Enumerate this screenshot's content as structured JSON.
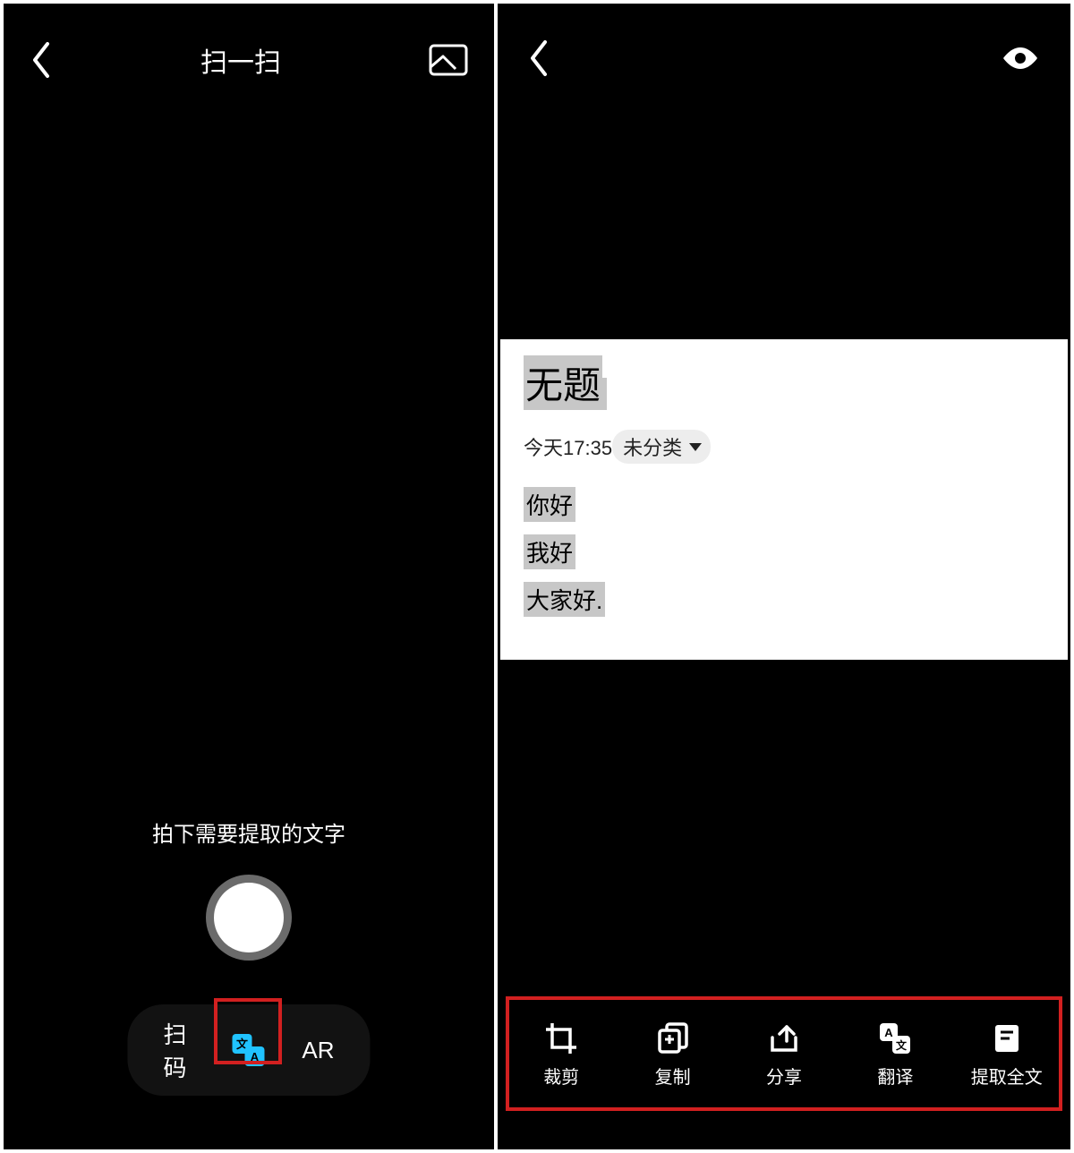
{
  "left": {
    "header_title": "扫一扫",
    "hint": "拍下需要提取的文字",
    "tabs": {
      "scan_code": "扫码",
      "ar": "AR"
    }
  },
  "right": {
    "doc": {
      "title": "无题",
      "time": "今天17:35",
      "category": "未分类",
      "lines": [
        "你好",
        "我好",
        "大家好."
      ]
    },
    "toolbar": {
      "crop": "裁剪",
      "copy": "复制",
      "share": "分享",
      "translate": "翻译",
      "extract": "提取全文"
    }
  }
}
